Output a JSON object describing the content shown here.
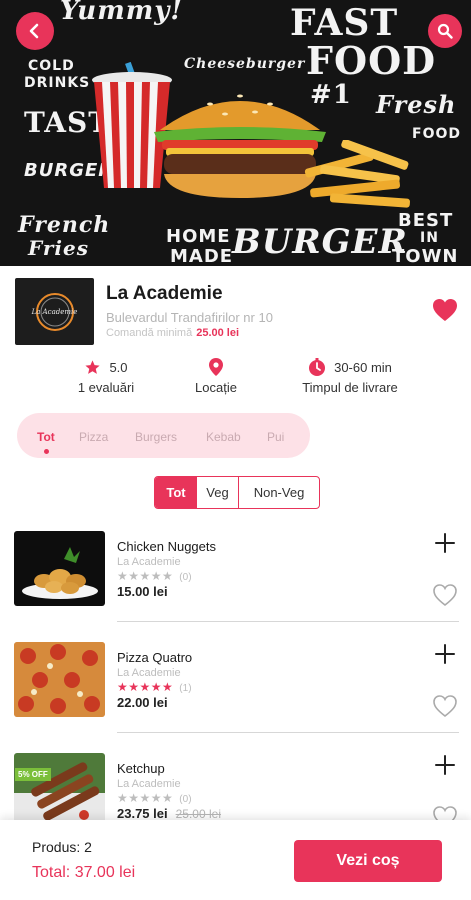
{
  "hero": {
    "chalk_texts": {
      "yummy": "Yummy!",
      "cold_drinks_1": "COLD",
      "cold_drinks_2": "DRINKS",
      "tasty": "TASTY",
      "burger_small": "BURGER",
      "cheeseburger": "Cheeseburger",
      "fast": "FAST",
      "food": "FOOD",
      "number_one": "#1",
      "fresh": "Fresh",
      "fresh_food": "FOOD",
      "french": "French",
      "fries": "Fries",
      "home": "HOME",
      "made": "MADE",
      "burger_big": "BURGER",
      "best": "BEST",
      "in": "IN",
      "town": "TOWN"
    },
    "back_icon": "chevron-left-icon",
    "search_icon": "search-icon",
    "accent": "#e8345a"
  },
  "restaurant": {
    "logo_text": "La Academie",
    "name": "La Academie",
    "address": "Bulevardul Trandafirilor nr 10",
    "min_order_label": "Comandă minimă",
    "min_order_value": "25.00 lei",
    "favorite": true
  },
  "stats": {
    "rating_value": "5.0",
    "rating_label": "1 evaluări",
    "location_label": "Locație",
    "delivery_time": "30-60 min",
    "delivery_label": "Timpul de livrare"
  },
  "categories": {
    "items": [
      "Tot",
      "Pizza",
      "Burgers",
      "Kebab",
      "Pui"
    ],
    "active_index": 0
  },
  "filters": {
    "items": [
      "Tot",
      "Veg",
      "Non-Veg"
    ],
    "active_index": 0
  },
  "products": [
    {
      "name": "Chicken Nuggets",
      "restaurant": "La Academie",
      "rating": 0,
      "rating_count": "(0)",
      "price": "15.00 lei",
      "old_price": "",
      "badge": ""
    },
    {
      "name": "Pizza Quatro",
      "restaurant": "La Academie",
      "rating": 5,
      "rating_count": "(1)",
      "price": "22.00 lei",
      "old_price": "",
      "badge": ""
    },
    {
      "name": "Ketchup",
      "restaurant": "La Academie",
      "rating": 0,
      "rating_count": "(0)",
      "price": "23.75 lei",
      "old_price": "25.00 lei",
      "badge": "5% OFF"
    }
  ],
  "footer": {
    "count_label": "Produs: 2",
    "total_label": "Total: 37.00 lei",
    "cart_button": "Vezi coș"
  }
}
